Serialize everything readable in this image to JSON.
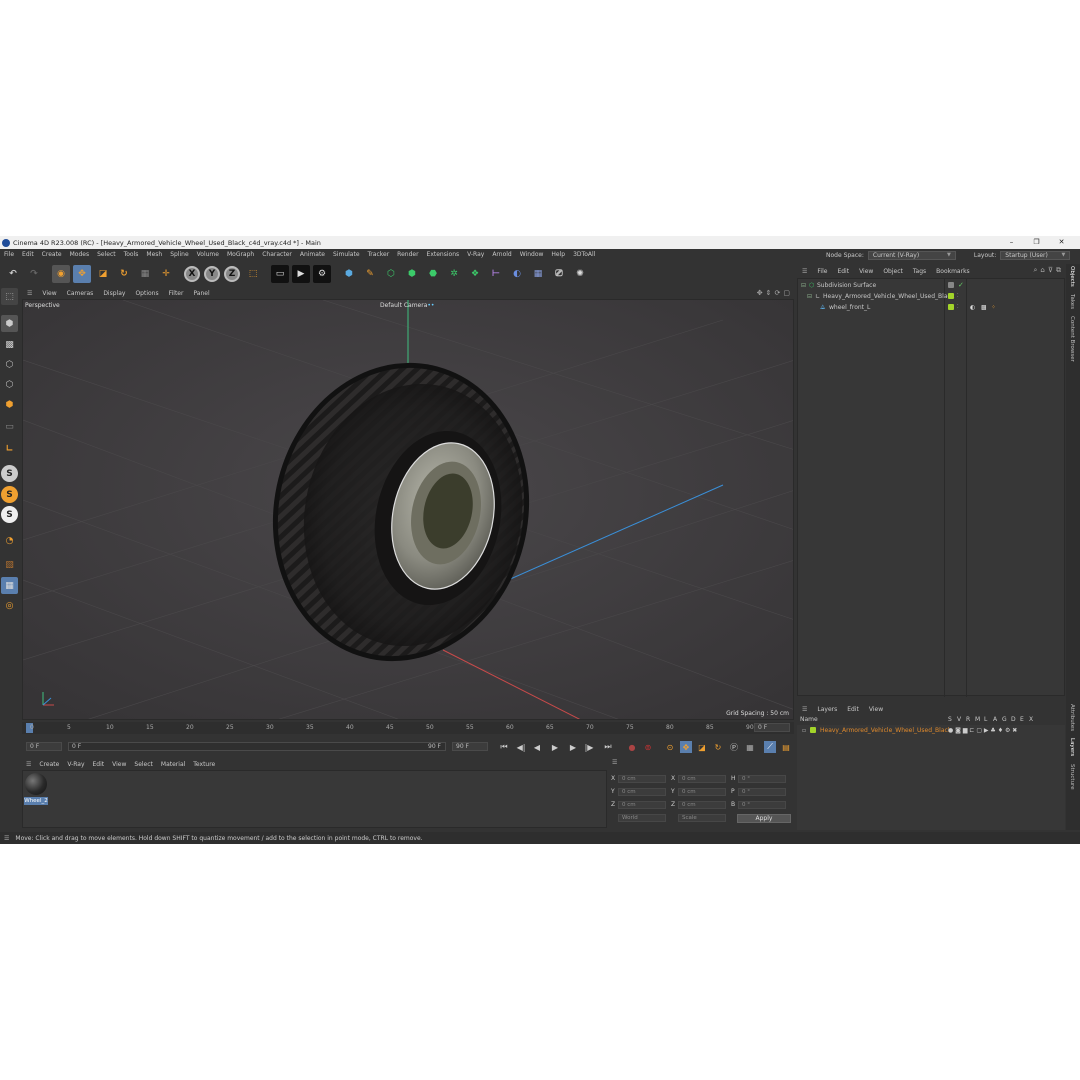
{
  "window": {
    "title": "Cinema 4D R23.008 (RC) - [Heavy_Armored_Vehicle_Wheel_Used_Black_c4d_vray.c4d *] - Main",
    "controls": [
      "–",
      "❐",
      "✕"
    ]
  },
  "menubar": {
    "items": [
      "File",
      "Edit",
      "Create",
      "Modes",
      "Select",
      "Tools",
      "Mesh",
      "Spline",
      "Volume",
      "MoGraph",
      "Character",
      "Animate",
      "Simulate",
      "Tracker",
      "Render",
      "Extensions",
      "V-Ray",
      "Arnold",
      "Window",
      "Help",
      "3DToAll"
    ],
    "node_space_label": "Node Space:",
    "node_space_value": "Current (V-Ray)",
    "layout_label": "Layout:",
    "layout_value": "Startup (User)"
  },
  "toolbar": {
    "axis": [
      "X",
      "Y",
      "Z"
    ]
  },
  "viewport": {
    "menus": [
      "View",
      "Cameras",
      "Display",
      "Options",
      "Filter",
      "Panel"
    ],
    "projection": "Perspective",
    "camera": "Default Camera",
    "camera_mark": "••",
    "grid_spacing": "Grid Spacing : 50 cm",
    "background_color": "#3f3d3f"
  },
  "timeline": {
    "ticks": [
      "0",
      "5",
      "10",
      "15",
      "20",
      "25",
      "30",
      "35",
      "40",
      "45",
      "50",
      "55",
      "60",
      "65",
      "70",
      "75",
      "80",
      "85",
      "90"
    ],
    "current_frame": "0 F",
    "start_frame": "0 F",
    "range_start": "0 F",
    "range_end": "90 F",
    "end_frame": "90 F",
    "right_frame": "0 F"
  },
  "material_manager": {
    "menus": [
      "Create",
      "V-Ray",
      "Edit",
      "View",
      "Select",
      "Material",
      "Texture"
    ],
    "materials": [
      {
        "name": "Wheel_2"
      }
    ]
  },
  "coordinates": {
    "pos_labels": [
      "X",
      "Y",
      "Z"
    ],
    "rot_labels": [
      "X",
      "Y",
      "Z"
    ],
    "angle_labels": [
      "H",
      "P",
      "B"
    ],
    "pos_values": [
      "0 cm",
      "0 cm",
      "0 cm"
    ],
    "size_values": [
      "0 cm",
      "0 cm",
      "0 cm"
    ],
    "angle_values": [
      "0 °",
      "0 °",
      "0 °"
    ],
    "mode_world": "World",
    "mode_scale": "Scale",
    "apply_label": "Apply"
  },
  "status": {
    "text": "Move: Click and drag to move elements. Hold down SHIFT to quantize movement / add to the selection in point mode, CTRL to remove."
  },
  "object_manager": {
    "menus": [
      "File",
      "Edit",
      "View",
      "Object",
      "Tags",
      "Bookmarks"
    ],
    "objects": [
      {
        "name": "Subdivision Surface",
        "indent": 0
      },
      {
        "name": "Heavy_Armored_Vehicle_Wheel_Used_Black",
        "indent": 1
      },
      {
        "name": "wheel_front_L",
        "indent": 2
      }
    ],
    "accent_color": "#a3d42a"
  },
  "layers": {
    "menus": [
      "Layers",
      "Edit",
      "View"
    ],
    "name_column": "Name",
    "flag_columns": [
      "S",
      "V",
      "R",
      "M",
      "L",
      "A",
      "G",
      "D",
      "E",
      "X"
    ],
    "items": [
      {
        "name": "Heavy_Armored_Vehicle_Wheel_Used_Black",
        "color": "#e08a2c"
      }
    ]
  },
  "side_tabs": [
    "Objects",
    "Takes",
    "Content Browser",
    "Attributes",
    "Layers",
    "Structure"
  ]
}
